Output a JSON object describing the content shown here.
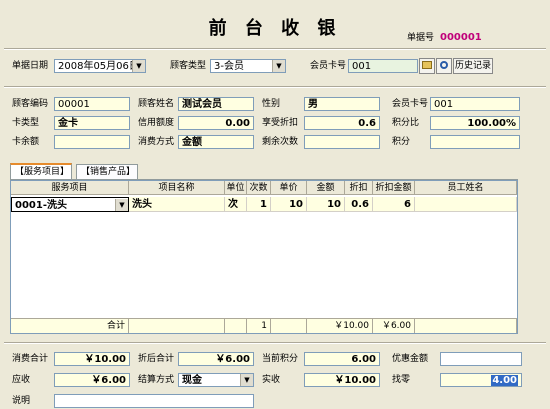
{
  "title": "前 台 收 银",
  "doc_no": {
    "label": "单据号",
    "value": "000001"
  },
  "header_row": {
    "date_label": "单据日期",
    "date_value": "2008年05月06日",
    "cust_type_label": "顾客类型",
    "cust_type_value": "3-会员",
    "card_label": "会员卡号",
    "card_value": "001",
    "history_button": "历史记录"
  },
  "customer": {
    "code_label": "顾客编码",
    "code_value": "00001",
    "name_label": "顾客姓名",
    "name_value": "测试会员",
    "gender_label": "性别",
    "gender_value": "男",
    "card_label": "会员卡号",
    "card_value": "001",
    "card_type_label": "卡类型",
    "card_type_value": "金卡",
    "credit_label": "信用额度",
    "credit_value": "0.00",
    "discount_label": "享受折扣",
    "discount_value": "0.6",
    "points_ratio_label": "积分比",
    "points_ratio_value": "100.00%",
    "balance_label": "卡余额",
    "balance_value": "",
    "consume_label": "消费方式",
    "consume_value": "金额",
    "remain_label": "剩余次数",
    "remain_value": "",
    "points_label": "积分",
    "points_value": ""
  },
  "tabs": [
    {
      "label": "【服务项目】"
    },
    {
      "label": "【销售产品】"
    }
  ],
  "grid": {
    "columns": [
      "服务项目",
      "项目名称",
      "单位",
      "次数",
      "单价",
      "金额",
      "折扣",
      "折扣金额",
      "员工姓名"
    ],
    "row": [
      "0001-洗头",
      "洗头",
      "次",
      "1",
      "10",
      "10",
      "0.6",
      "6",
      ""
    ],
    "total_label": "合计",
    "total_count": "1",
    "total_amount": "￥10.00",
    "total_disc_amount": "￥6.00"
  },
  "footer": {
    "consume_total_label": "消费合计",
    "consume_total_value": "￥10.00",
    "after_disc_label": "折后合计",
    "after_disc_value": "￥6.00",
    "current_points_label": "当前积分",
    "current_points_value": "6.00",
    "offset_label": "优惠金额",
    "offset_value": "",
    "receivable_label": "应收",
    "receivable_value": "￥6.00",
    "settle_label": "结算方式",
    "settle_value": "现金",
    "received_label": "实收",
    "received_value": "￥10.00",
    "change_label": "找零",
    "change_value": "4.00",
    "note_label": "说明"
  }
}
